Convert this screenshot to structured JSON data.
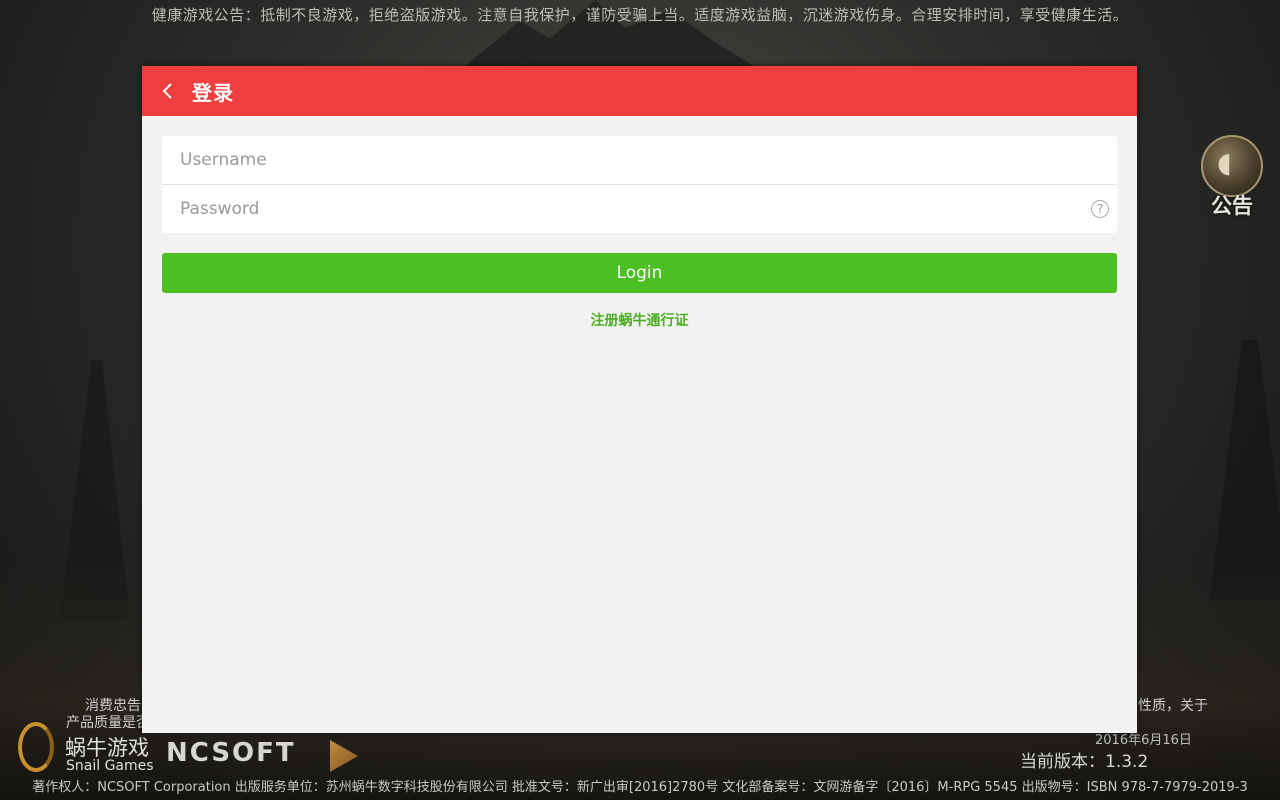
{
  "notice": "健康游戏公告：抵制不良游戏，拒绝盗版游戏。注意自我保护，谨防受骗上当。适度游戏益脑，沉迷游戏伤身。合理安排时间，享受健康生活。",
  "announcement": {
    "label": "公告",
    "icon": "megaphone-icon"
  },
  "background_text": {
    "left_line1": "消费忠告",
    "left_line2": "产品质量是否",
    "right_line1": "性质，关于"
  },
  "login_dialog": {
    "title": "登录",
    "back_icon": "chevron-left-icon",
    "username_placeholder": "Username",
    "password_placeholder": "Password",
    "help_icon": "?",
    "login_button": "Login",
    "register_link": "注册蜗牛通行证",
    "colors": {
      "header": "#ee3e3e",
      "button": "#4cbf22",
      "link": "#4cae22"
    }
  },
  "brand": {
    "snail_cn": "蜗牛游戏",
    "snail_en": "Snail Games",
    "ncsoft": "NCSOFT"
  },
  "date": "2016年6月16日",
  "version": "当前版本：1.3.2",
  "footer": "著作权人：NCSOFT Corporation 出版服务单位：苏州蜗牛数字科技股份有限公司 批准文号：新广出审[2016]2780号 文化部备案号：文网游备字〔2016〕M-RPG 5545 出版物号：ISBN 978-7-7979-2019-3"
}
